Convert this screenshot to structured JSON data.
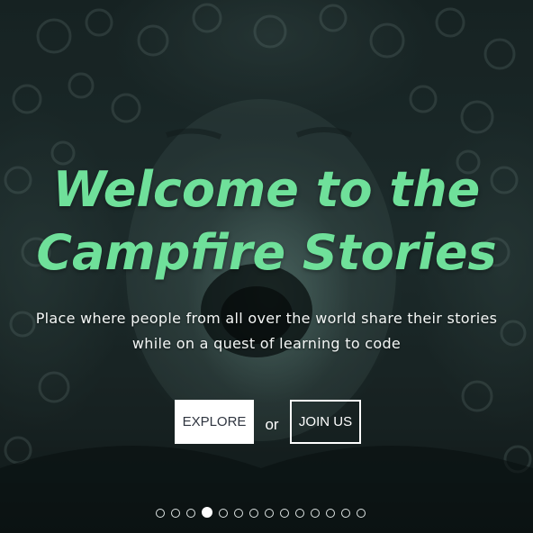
{
  "hero": {
    "title_line1": "Welcome to the",
    "title_line2": "Campfire Stories",
    "subtitle_line1": "Place where people from all over the world share their stories",
    "subtitle_line2": "while on a quest of learning to code",
    "explore_label": "EXPLORE",
    "or_label": "or",
    "join_label": "JOIN US"
  },
  "carousel": {
    "total_slides": 14,
    "active_index": 3
  },
  "colors": {
    "title": "#6fe09a",
    "text": "#ffffff",
    "explore_text": "#2f3540"
  }
}
